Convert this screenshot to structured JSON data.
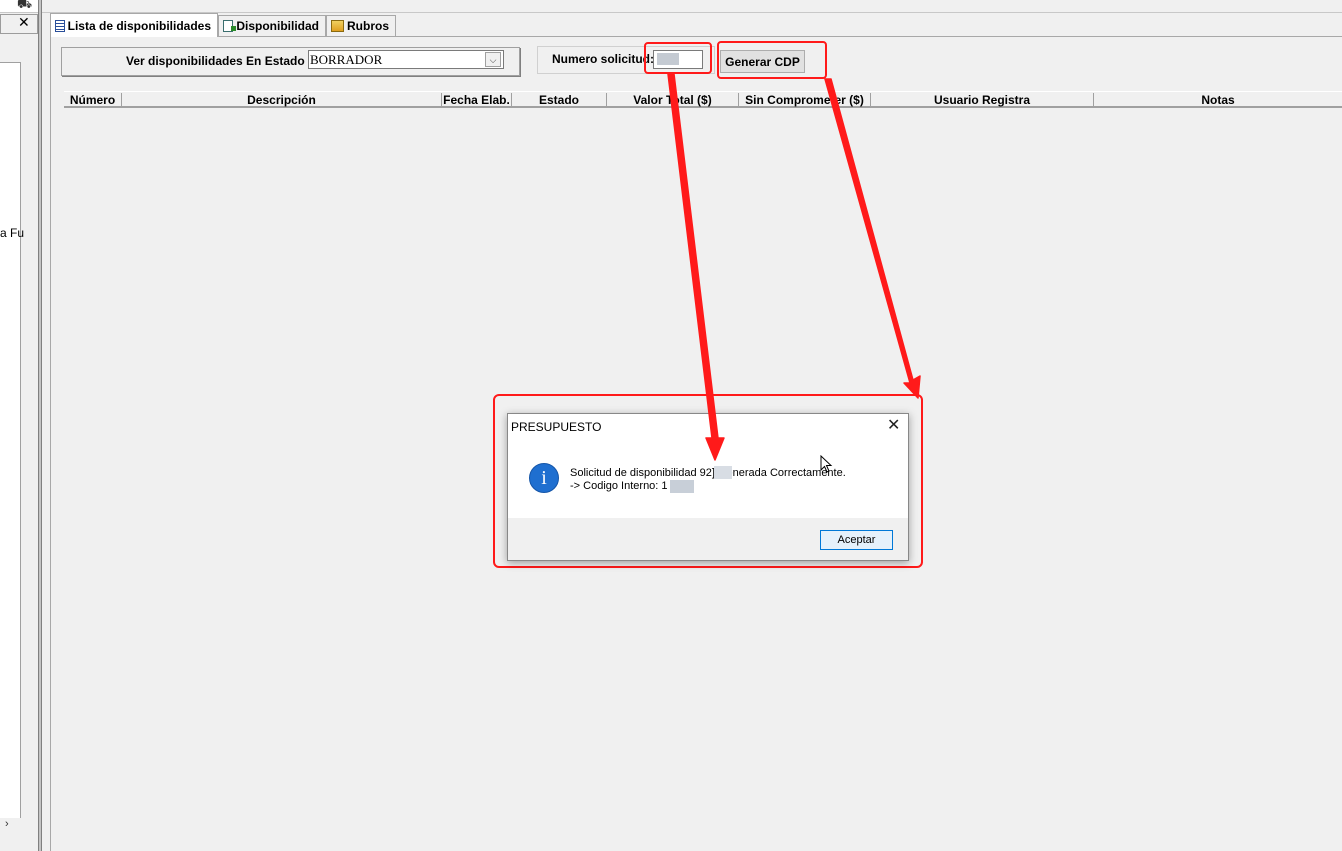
{
  "left_panel": {
    "toolbar_icon": "⛟",
    "close_icon": "✕",
    "truncated_text": "a Fu",
    "scroll_arrow": "›"
  },
  "tabs": [
    {
      "label": "Lista de disponibilidades",
      "icon": "list-icon",
      "active": true
    },
    {
      "label": "Disponibilidad",
      "icon": "document-icon",
      "active": false
    },
    {
      "label": "Rubros",
      "icon": "folder-icon",
      "active": false
    }
  ],
  "filter": {
    "label": "Ver disponibilidades En Estado",
    "selected": "BORRADOR",
    "arrow": "⌵"
  },
  "solicitud": {
    "label": "Numero solicitud:",
    "value": ""
  },
  "actions": {
    "generar_label": "Generar CDP"
  },
  "table": {
    "columns": [
      "Número",
      "Descripción",
      "Fecha Elab.",
      "Estado",
      "Valor Total ($)",
      "Sin Comprometer ($)",
      "Usuario Registra",
      "Notas"
    ],
    "rows": []
  },
  "dialog": {
    "title": "PRESUPUESTO",
    "close_glyph": "✕",
    "info_glyph": "i",
    "line1": "Solicitud de disponibilidad       92] Generada Correctamente.",
    "line2": "-> Codigo Interno:          1",
    "ok_label": "Aceptar"
  },
  "colors": {
    "annotation_red": "#ff1a1a",
    "info_blue": "#1f6fd0",
    "default_button_border": "#0078d7"
  }
}
